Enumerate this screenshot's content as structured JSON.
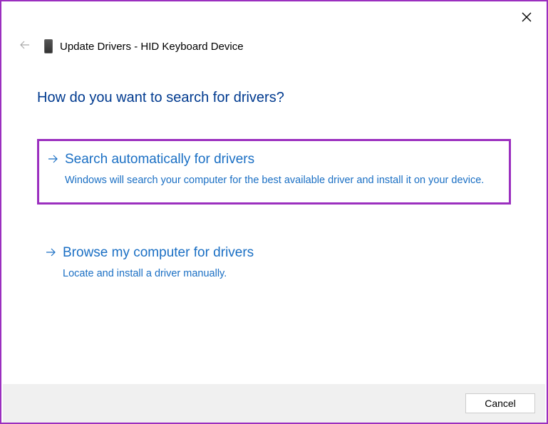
{
  "header": {
    "title": "Update Drivers - HID Keyboard Device"
  },
  "main": {
    "heading": "How do you want to search for drivers?"
  },
  "options": [
    {
      "title": "Search automatically for drivers",
      "description": "Windows will search your computer for the best available driver and install it on your device."
    },
    {
      "title": "Browse my computer for drivers",
      "description": "Locate and install a driver manually."
    }
  ],
  "footer": {
    "cancel_label": "Cancel"
  }
}
